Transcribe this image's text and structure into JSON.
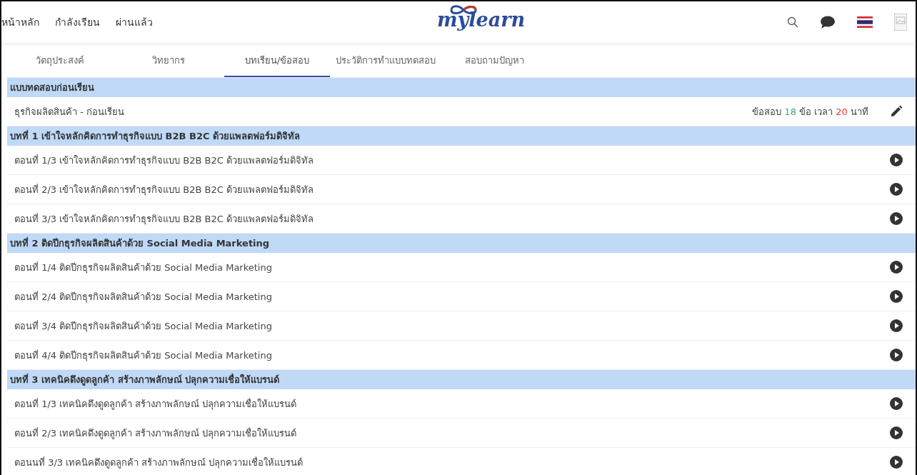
{
  "nav": [
    {
      "label": "หน้าหลัก"
    },
    {
      "label": "กำลังเรียน"
    },
    {
      "label": "ผ่านแล้ว"
    }
  ],
  "logo": "mylearn",
  "tabs": [
    {
      "label": "วัตถุประสงค์",
      "selected": false
    },
    {
      "label": "วิทยากร",
      "selected": false
    },
    {
      "label": "บทเรียน/ข้อสอบ",
      "selected": true
    },
    {
      "label": "ประวัติการทำแบบทดสอบ",
      "selected": false
    },
    {
      "label": "สอบถามปัญหา",
      "selected": false
    }
  ],
  "sections": [
    {
      "title": "แบบทดสอบก่อนเรียน",
      "items": [
        {
          "kind": "exam",
          "title": "ธุรกิจผลิตสินค้า - ก่อนเรียน",
          "prefix": "ข้อสอบ",
          "questions": "18",
          "middle": "ข้อ เวลา",
          "minutes": "20",
          "suffix": "นาที"
        }
      ]
    },
    {
      "title": "บทที่ 1 เข้าใจหลักคิดการทำธุรกิจแบบ B2B B2C ด้วยแพลตฟอร์มดิจิทัล",
      "items": [
        {
          "kind": "video",
          "title": "ตอนที่ 1/3 เข้าใจหลักคิดการทำธุรกิจแบบ B2B B2C ด้วยแพลตฟอร์มดิจิทัล"
        },
        {
          "kind": "video",
          "title": "ตอนที่ 2/3 เข้าใจหลักคิดการทำธุรกิจแบบ B2B B2C ด้วยแพลตฟอร์มดิจิทัล"
        },
        {
          "kind": "video",
          "title": "ตอนที่ 3/3 เข้าใจหลักคิดการทำธุรกิจแบบ B2B B2C ด้วยแพลตฟอร์มดิจิทัล"
        }
      ]
    },
    {
      "title": "บทที่ 2 ติดปีกธุรกิจผลิตสินค้าด้วย Social Media Marketing",
      "items": [
        {
          "kind": "video",
          "title": "ตอนที่ 1/4 ติดปีกธุรกิจผลิตสินค้าด้วย Social Media Marketing"
        },
        {
          "kind": "video",
          "title": "ตอนที่ 2/4 ติดปีกธุรกิจผลิตสินค้าด้วย Social Media Marketing"
        },
        {
          "kind": "video",
          "title": "ตอนที่ 3/4 ติดปีกธุรกิจผลิตสินค้าด้วย Social Media Marketing"
        },
        {
          "kind": "video",
          "title": "ตอนที่ 4/4 ติดปีกธุรกิจผลิตสินค้าด้วย Social Media Marketing"
        }
      ]
    },
    {
      "title": "บทที่ 3 เทคนิคดึงดูดลูกค้า สร้างภาพลักษณ์ ปลุกความเชื่อให้แบรนด์",
      "items": [
        {
          "kind": "video",
          "title": "ตอนที่ 1/3 เทคนิคดึงดูดลูกค้า สร้างภาพลักษณ์ ปลุกความเชื่อให้แบรนด์"
        },
        {
          "kind": "video",
          "title": "ตอนที่ 2/3 เทคนิคดึงดูดลูกค้า สร้างภาพลักษณ์ ปลุกความเชื่อให้แบรนด์"
        },
        {
          "kind": "video",
          "title": "ตอนนที่ 3/3 เทคนิคดึงดูดลูกค้า สร้างภาพลักษณ์ ปลุกความเชื่อให้แบรนด์"
        }
      ]
    }
  ]
}
